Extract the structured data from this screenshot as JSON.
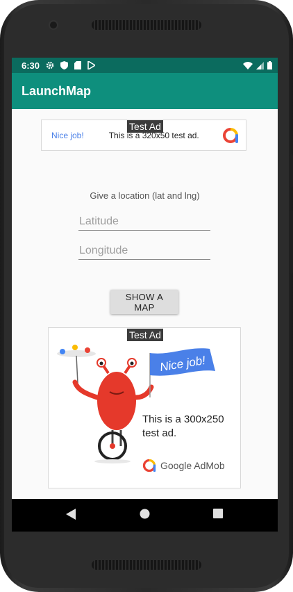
{
  "status": {
    "time": "6:30"
  },
  "app": {
    "title": "LaunchMap"
  },
  "banner_ad": {
    "label": "Test Ad",
    "nice": "Nice job!",
    "text": "This is a 320x50 test ad."
  },
  "form": {
    "prompt": "Give a location (lat and lng)",
    "latitude_placeholder": "Latitude",
    "longitude_placeholder": "Longitude",
    "button": "SHOW A MAP"
  },
  "mrec_ad": {
    "label": "Test Ad",
    "flag_text": "Nice job!",
    "text": "This is a 300x250 test ad.",
    "brand": "Google AdMob"
  },
  "icons": [
    "settings-icon",
    "shield-icon",
    "sd-card-icon",
    "play-store-icon",
    "wifi-icon",
    "signal-icon",
    "battery-icon",
    "back-icon",
    "home-icon",
    "recents-icon"
  ],
  "colors": {
    "status_bar": "#0b6b5e",
    "app_bar": "#0e8f7d"
  }
}
